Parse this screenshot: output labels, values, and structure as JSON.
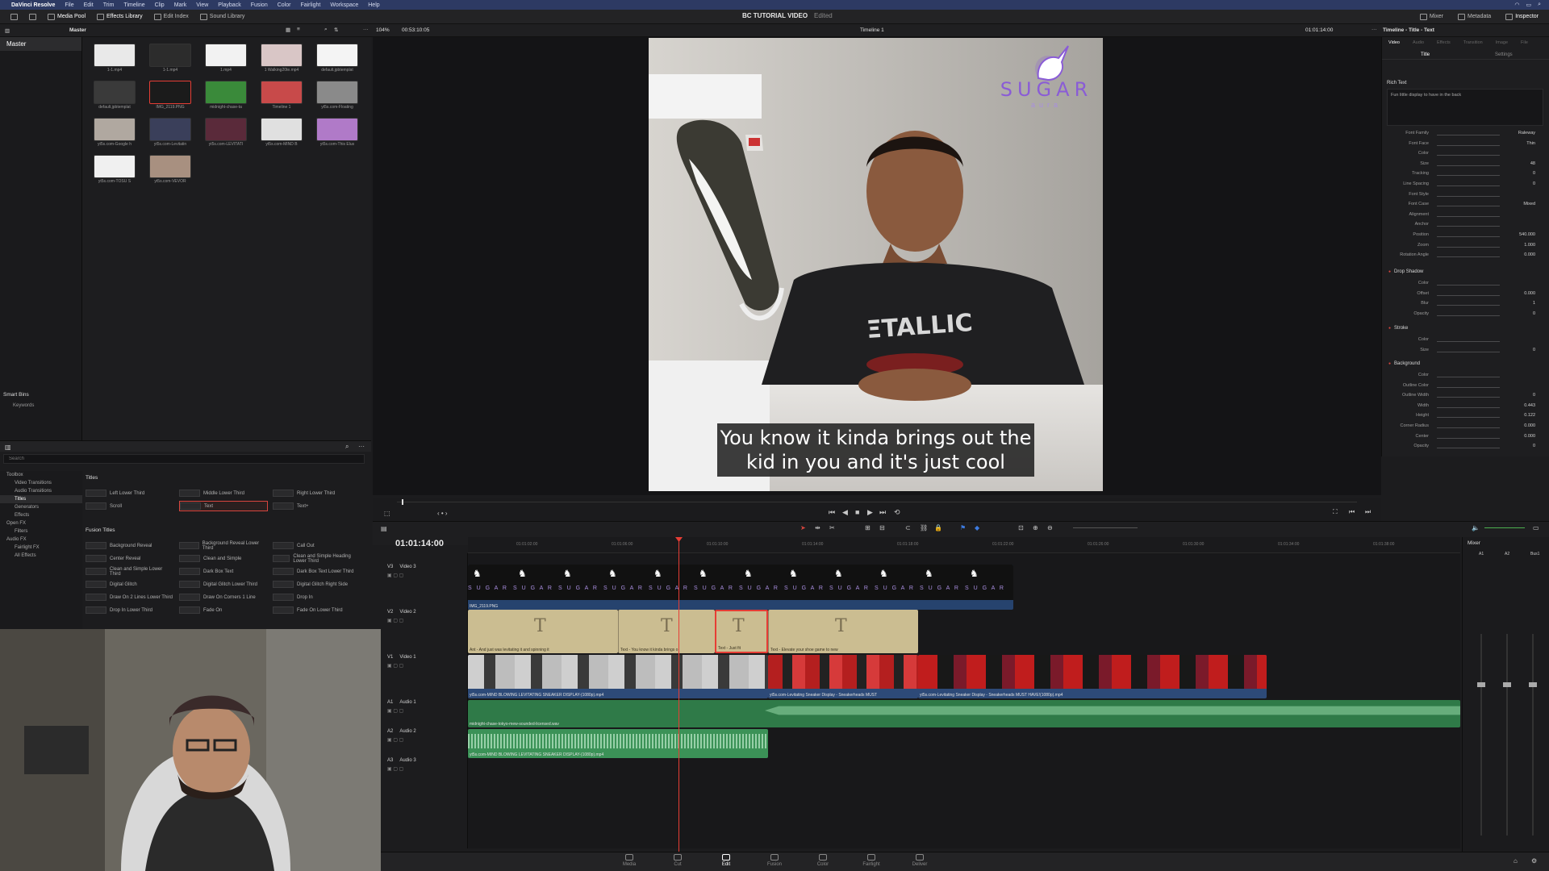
{
  "menu": {
    "app": "DaVinci Resolve",
    "items": [
      "File",
      "Edit",
      "Trim",
      "Timeline",
      "Clip",
      "Mark",
      "View",
      "Playback",
      "Fusion",
      "Color",
      "Fairlight",
      "Workspace",
      "Help"
    ]
  },
  "toolbar": {
    "media_pool": "Media Pool",
    "effects_library": "Effects Library",
    "edit_index": "Edit Index",
    "sound_library": "Sound Library",
    "project_title": "BC TUTORIAL VIDEO",
    "project_status": "Edited",
    "mixer": "Mixer",
    "metadata": "Metadata",
    "inspector": "Inspector"
  },
  "subbar": {
    "bin": "Master",
    "zoom": "104%",
    "source_tc": "00:53:10:05",
    "timeline_name": "Timeline 1",
    "record_tc": "01:01:14:00",
    "inspector_title": "Timeline - Title - Text"
  },
  "bins": {
    "master": "Master",
    "smart_bins": "Smart Bins",
    "keywords": "Keywords"
  },
  "clips": [
    "1-1.mp4",
    "1-1.mp4",
    "1.mp4",
    "1 Walking20te.mp4",
    "default.jpbtemplat",
    "default.jpbtemplat",
    "IMG_2119.PNG",
    "midnight-chase-ta",
    "Timeline 1",
    "yt5s.com-Floating",
    "yt5s.com-Google h",
    "yt5s.com-Levitatin",
    "yt5s.com-LEVITATI",
    "yt5s.com-MIND B",
    "yt5s.com-This Elus",
    "yt5s.com-TOSU S",
    "yt5s.com-VEVOR"
  ],
  "effects": {
    "search_placeholder": "Search",
    "tree": [
      "Toolbox",
      "Video Transitions",
      "Audio Transitions",
      "Titles",
      "Generators",
      "Effects",
      "Open FX",
      "Filters",
      "Audio FX",
      "Fairlight FX",
      "All Effects"
    ],
    "titles_header": "Titles",
    "titles": [
      "Left Lower Third",
      "Middle Lower Third",
      "Right Lower Third",
      "Scroll",
      "Text",
      "Text+"
    ],
    "fusion_header": "Fusion Titles",
    "fusion_titles": [
      "Background Reveal",
      "Background Reveal Lower Third",
      "Call Out",
      "Center Reveal",
      "Clean and Simple",
      "Clean and Simple Heading Lower Third",
      "Clean and Simple Lower Third",
      "Dark Box Text",
      "Dark Box Text Lower Third",
      "Digital Glitch",
      "Digital Glitch Lower Third",
      "Digital Glitch Right Side",
      "Draw On 2 Lines Lower Third",
      "Draw On Corners 1 Line",
      "Drop In",
      "Drop In Lower Third",
      "Fade On",
      "Fade On Lower Third"
    ]
  },
  "viewer": {
    "logo": "SUGAR",
    "logo_sub": "aura",
    "subtitle": "You know it kinda brings out the kid in you and it's just cool"
  },
  "inspector": {
    "tabs": [
      "Video",
      "Audio",
      "Effects",
      "Transition",
      "Image",
      "File"
    ],
    "subtabs": [
      "Title",
      "Settings"
    ],
    "rich_text": "Rich Text",
    "text_value": "Fun little display to have in the back",
    "rows": [
      {
        "label": "Font Family",
        "value": "Raleway"
      },
      {
        "label": "Font Face",
        "value": "Thin"
      },
      {
        "label": "Color",
        "value": ""
      },
      {
        "label": "Size",
        "value": "48"
      },
      {
        "label": "Tracking",
        "value": "0"
      },
      {
        "label": "Line Spacing",
        "value": "0"
      },
      {
        "label": "Font Style",
        "value": ""
      },
      {
        "label": "Font Case",
        "value": "Mixed"
      },
      {
        "label": "Alignment",
        "value": ""
      },
      {
        "label": "Anchor",
        "value": ""
      },
      {
        "label": "Position",
        "value": "540.000"
      },
      {
        "label": "Zoom",
        "value": "1.000"
      },
      {
        "label": "Rotation Angle",
        "value": "0.000"
      }
    ],
    "drop_shadow": "Drop Shadow",
    "ds_rows": [
      {
        "label": "Color",
        "value": ""
      },
      {
        "label": "Offset",
        "value": "0.000"
      },
      {
        "label": "Blur",
        "value": "1"
      },
      {
        "label": "Opacity",
        "value": "0"
      }
    ],
    "stroke": "Stroke",
    "stroke_rows": [
      {
        "label": "Color",
        "value": ""
      },
      {
        "label": "Size",
        "value": "0"
      }
    ],
    "background": "Background",
    "bg_rows": [
      {
        "label": "Color",
        "value": ""
      },
      {
        "label": "Outline Color",
        "value": ""
      },
      {
        "label": "Outline Width",
        "value": "0"
      },
      {
        "label": "Width",
        "value": "0.443"
      },
      {
        "label": "Height",
        "value": "0.122"
      },
      {
        "label": "Corner Radius",
        "value": "0.000"
      },
      {
        "label": "Center",
        "value": "0.000"
      },
      {
        "label": "Opacity",
        "value": "0"
      }
    ]
  },
  "timeline": {
    "timecode": "01:01:14:00",
    "tracks": [
      {
        "id": "V3",
        "name": "Video 3"
      },
      {
        "id": "V2",
        "name": "Video 2"
      },
      {
        "id": "V1",
        "name": "Video 1"
      },
      {
        "id": "A1",
        "name": "Audio 1"
      },
      {
        "id": "A2",
        "name": "Audio 2"
      },
      {
        "id": "A3",
        "name": "Audio 3"
      }
    ],
    "clip_labels": {
      "v3": "IMG_2119.PNG",
      "v2a": "Ant - And just was levitating it and spinning it",
      "v2b": "Text - You know it kinda brings o",
      "v2c": "Text - Just fit",
      "v2d": "Text - Elevate your shoe game to new",
      "v1a": "yt5s.com-MIND BLOWING LEVITATING SNEAKER DISPLAY-(1080p).mp4",
      "v1b": "yt5s.com-Levitating Sneaker Display - Sneakerheads MUST",
      "v1c": "yt5s.com-Levitating Sneaker Display - Sneakerheads MUST HAVE!(1080p).mp4",
      "a1": "midnight-chase-tokyo-mew-sounded-licensed.wav",
      "a2": "yt5s.com-MIND BLOWING LEVITATING SNEAKER DISPLAY-(1080p).mp4"
    },
    "ruler_ticks": [
      "01:01:02:00",
      "01:01:06:00",
      "01:01:10:00",
      "01:01:14:00",
      "01:01:18:00",
      "01:01:22:00",
      "01:01:26:00",
      "01:01:30:00",
      "01:01:34:00",
      "01:01:38:00"
    ],
    "mixer_title": "Mixer",
    "mixer_channels": [
      "A1",
      "A2",
      "Bus1"
    ]
  },
  "pages": [
    "Media",
    "Cut",
    "Edit",
    "Fusion",
    "Color",
    "Fairlight",
    "Deliver"
  ],
  "colors": {
    "accent": "#e63d35",
    "video_clip": "#3d5a87",
    "title_clip": "#c9bb8f",
    "audio_clip": "#3f9b5c"
  }
}
